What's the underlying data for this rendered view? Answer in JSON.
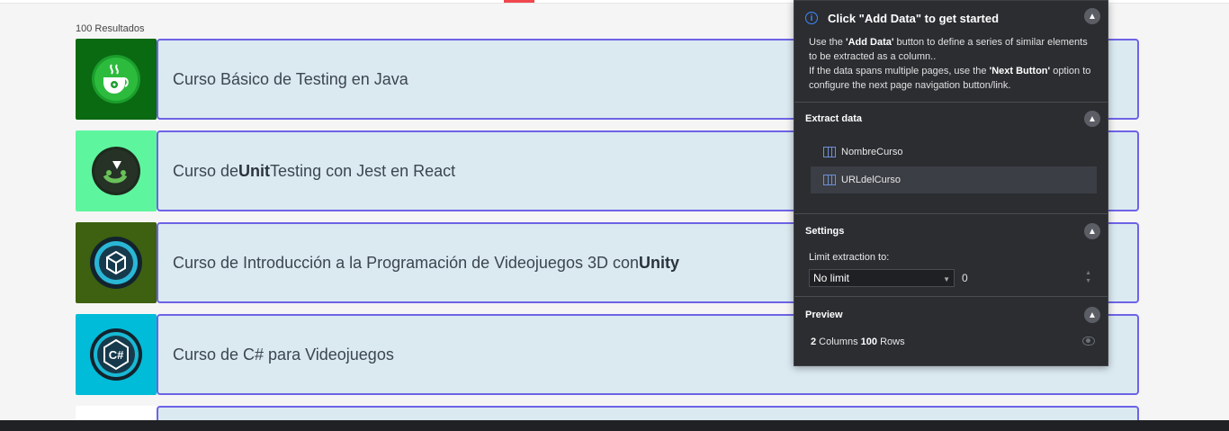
{
  "page": {
    "result_count": "100 Resultados",
    "courses": [
      {
        "pre": "Curso Básico de Testing en Java",
        "bold": "",
        "post": "",
        "thumb_bg": "#0a6a12",
        "icon": "java-testing-icon"
      },
      {
        "pre": "Curso de ",
        "bold": "Unit",
        "post": " Testing con Jest en React",
        "thumb_bg": "#5ef59f",
        "icon": "jest-icon"
      },
      {
        "pre": "Curso de Introducción a la Programación de Videojuegos 3D con ",
        "bold": "Unity",
        "post": "",
        "thumb_bg": "#3d6110",
        "icon": "unity-icon"
      },
      {
        "pre": "Curso de C# para Videojuegos",
        "bold": "",
        "post": "",
        "thumb_bg": "#00bcd8",
        "icon": "csharp-icon"
      }
    ]
  },
  "panel": {
    "title": "Click \"Add Data\" to get started",
    "desc_1": "Use the ",
    "desc_add": "'Add Data'",
    "desc_2": " button to define a series of similar elements to be extracted as a column..",
    "desc_3": "If the data spans multiple pages, use the ",
    "desc_next": "'Next Button'",
    "desc_4": " option to configure the next page navigation button/link.",
    "extract_title": "Extract data",
    "columns": [
      "NombreCurso",
      "URLdelCurso"
    ],
    "settings_title": "Settings",
    "limit_label": "Limit extraction to:",
    "limit_value": "No limit",
    "limit_number": "0",
    "preview_title": "Preview",
    "preview_columns": "2",
    "preview_columns_label": " Columns  ",
    "preview_rows": "100",
    "preview_rows_label": " Rows"
  },
  "colors": {
    "accent": "#6e63e6",
    "card_bg": "#dbeaf1",
    "panel_bg": "#2b2d31",
    "info": "#3d8bfd"
  }
}
